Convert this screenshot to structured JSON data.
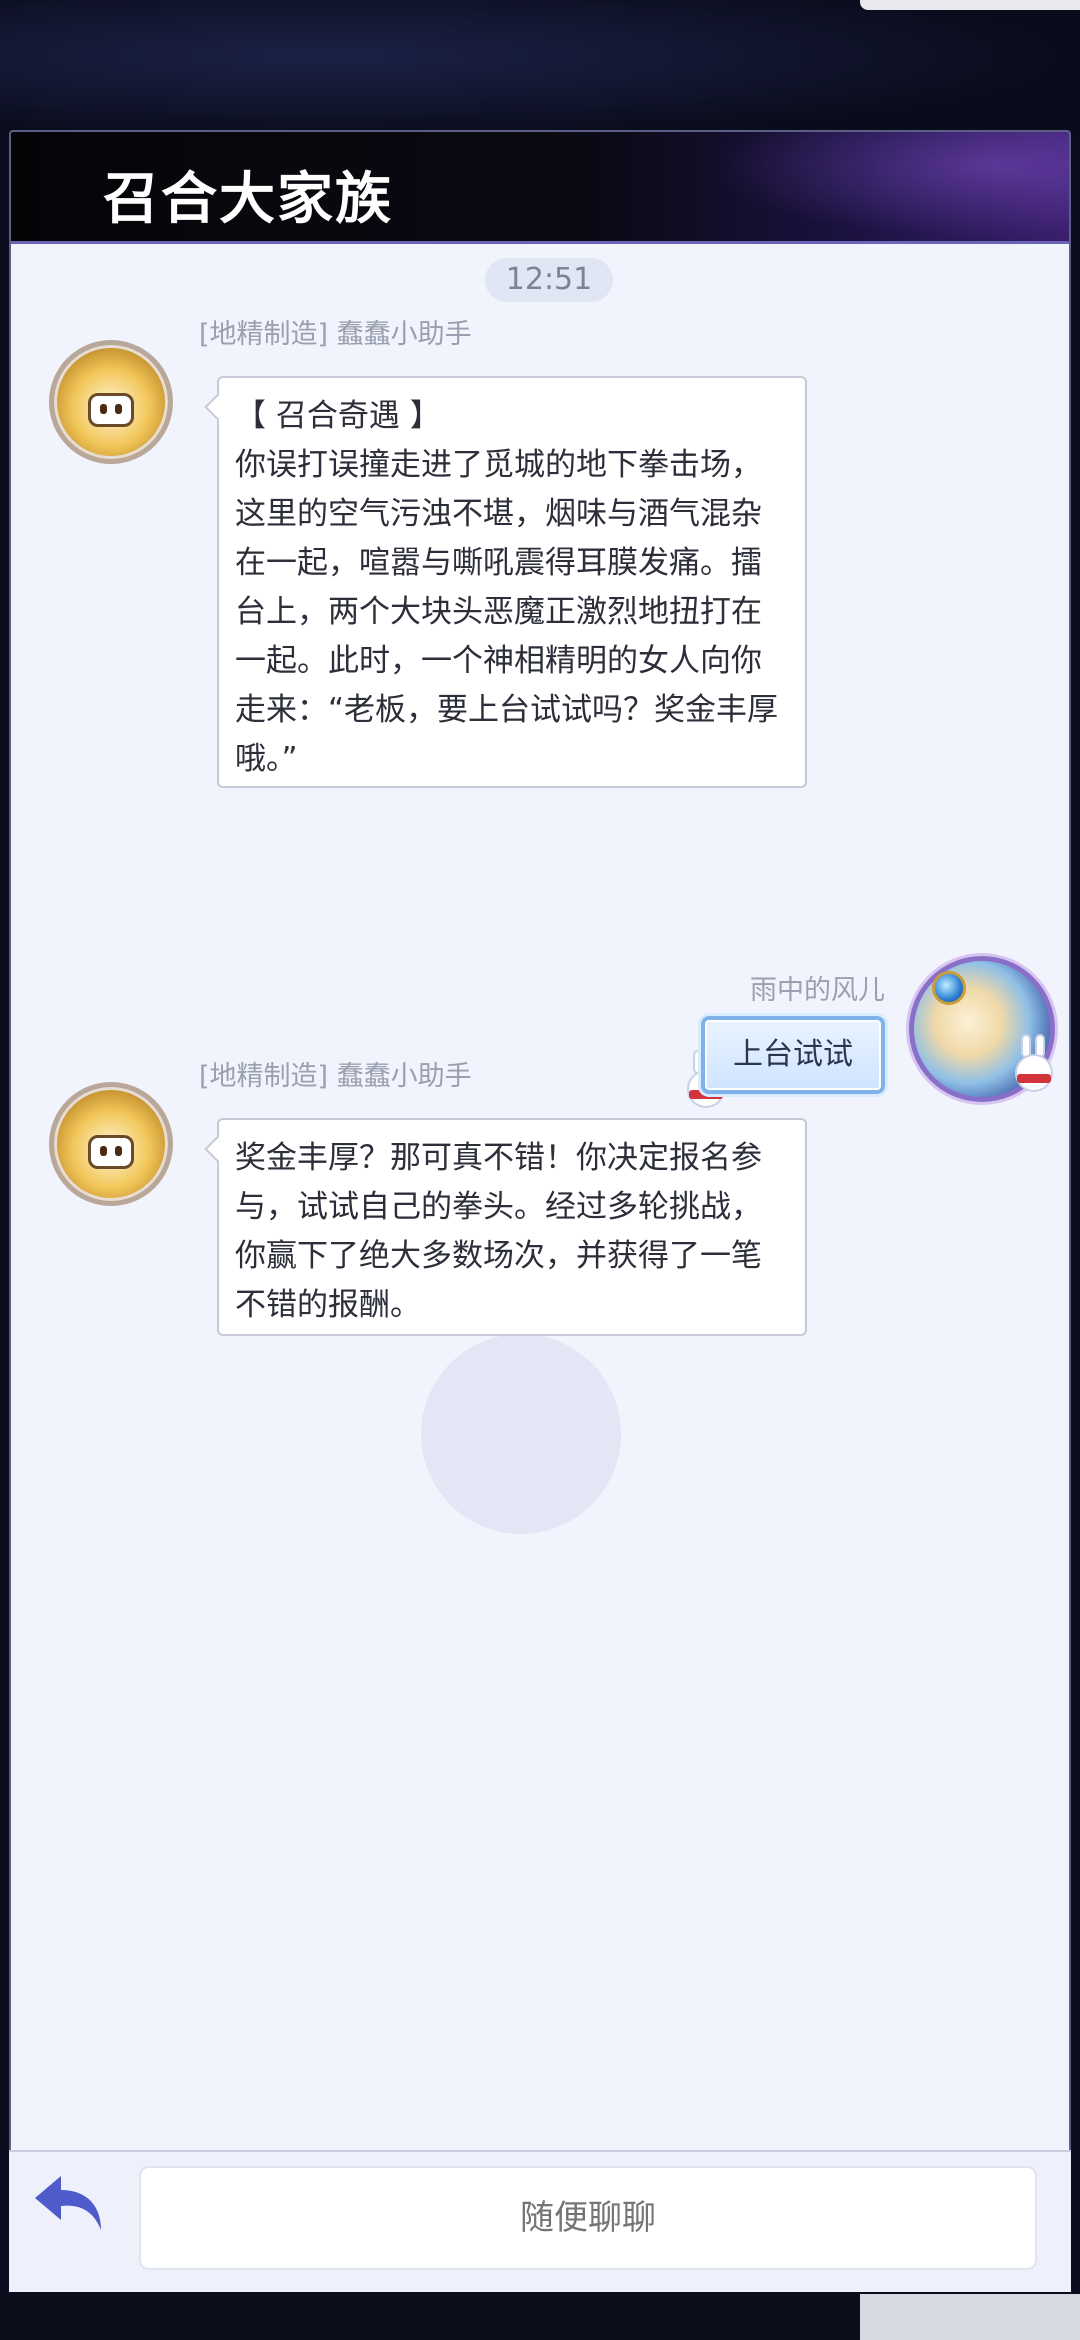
{
  "header": {
    "title": "召合大家族"
  },
  "chat": {
    "timestamp": "12:51",
    "messages": [
      {
        "side": "left",
        "sender": "[地精制造] 蠢蠢小助手",
        "text": "【 召合奇遇 】\n你误打误撞走进了觅城的地下拳击场，这里的空气污浊不堪，烟味与酒气混杂在一起，喧嚣与嘶吼震得耳膜发痛。擂台上，两个大块头恶魔正激烈地扭打在一起。此时，一个神相精明的女人向你走来：“老板，要上台试试吗？奖金丰厚哦。”"
      },
      {
        "side": "right",
        "sender": "雨中的风儿",
        "text": "上台试试"
      },
      {
        "side": "left",
        "sender": "[地精制造] 蠢蠢小助手",
        "text": "奖金丰厚？那可真不错！你决定报名参与，试试自己的拳头。经过多轮挑战，你赢下了绝大多数场次，并获得了一笔不错的报酬。"
      }
    ]
  },
  "footer": {
    "input_placeholder": "随便聊聊"
  }
}
